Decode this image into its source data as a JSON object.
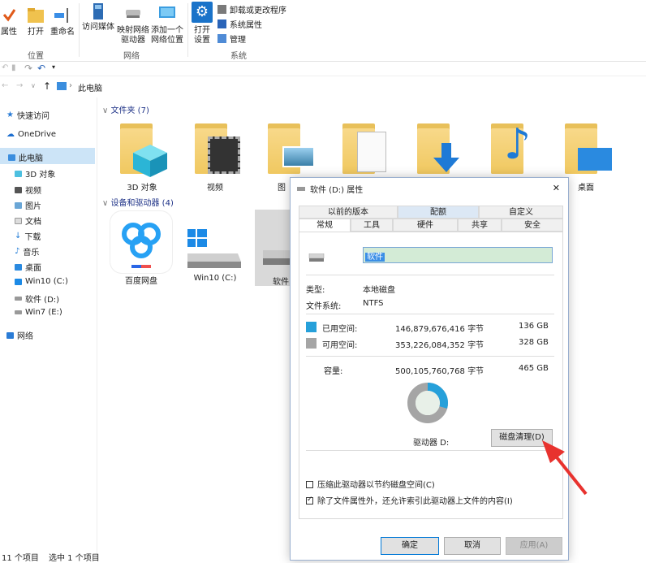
{
  "ribbon": {
    "properties": "属性",
    "open": "打开",
    "rename": "重命名",
    "access_media": "访问媒体",
    "map_drive_l1": "映射网络",
    "map_drive_l2": "驱动器",
    "add_location_l1": "添加一个",
    "add_location_l2": "网络位置",
    "open_settings_l1": "打开",
    "open_settings_l2": "设置",
    "uninstall": "卸载或更改程序",
    "system_properties": "系统属性",
    "manage": "管理",
    "group_location": "位置",
    "group_network": "网络",
    "group_system": "系统"
  },
  "address": {
    "path": "此电脑"
  },
  "nav": {
    "quick_access": "快速访问",
    "onedrive": "OneDrive",
    "this_pc": "此电脑",
    "objects3d": "3D 对象",
    "videos": "视频",
    "pictures": "图片",
    "documents": "文档",
    "downloads": "下载",
    "music": "音乐",
    "desktop": "桌面",
    "win10": "Win10 (C:)",
    "software": "软件 (D:)",
    "win7": "Win7 (E:)",
    "network": "网络"
  },
  "content": {
    "folders_header": "文件夹 (7)",
    "devices_header": "设备和驱动器 (4)",
    "folders": [
      "3D 对象",
      "视频",
      "图",
      "",
      "",
      "",
      "桌面"
    ],
    "devices": [
      "百度网盘",
      "Win10 (C:)",
      "软件"
    ]
  },
  "dialog": {
    "title": "软件 (D:) 属性",
    "close": "✕",
    "tabs_row1": [
      "以前的版本",
      "配额",
      "自定义"
    ],
    "tabs_row2": [
      "常规",
      "工具",
      "硬件",
      "共享",
      "安全"
    ],
    "drive_name": "软件",
    "type_label": "类型:",
    "type_value": "本地磁盘",
    "fs_label": "文件系统:",
    "fs_value": "NTFS",
    "used_label": "已用空间:",
    "used_bytes": "146,879,676,416 字节",
    "used_gb": "136 GB",
    "free_label": "可用空间:",
    "free_bytes": "353,226,084,352 字节",
    "free_gb": "328 GB",
    "capacity_label": "容量:",
    "capacity_bytes": "500,105,760,768 字节",
    "capacity_gb": "465 GB",
    "drive_letter": "驱动器 D:",
    "cleanup": "磁盘清理(D)",
    "compress": "压缩此驱动器以节约磁盘空间(C)",
    "index": "除了文件属性外，还允许索引此驱动器上文件的内容(I)",
    "ok": "确定",
    "cancel": "取消",
    "apply": "应用(A)",
    "used_fraction": 0.294,
    "used_color": "#26a0da",
    "free_color": "#a5a5a5"
  },
  "status": {
    "items": "11 个项目",
    "selected": "选中 1 个项目"
  }
}
